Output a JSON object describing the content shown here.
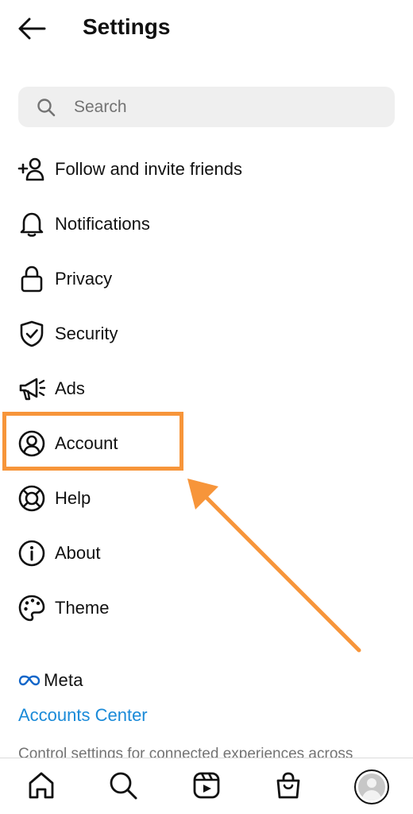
{
  "header": {
    "title": "Settings"
  },
  "search": {
    "placeholder": "Search"
  },
  "menu": {
    "items": [
      {
        "label": "Follow and invite friends",
        "icon": "add-person-icon"
      },
      {
        "label": "Notifications",
        "icon": "bell-icon"
      },
      {
        "label": "Privacy",
        "icon": "lock-icon"
      },
      {
        "label": "Security",
        "icon": "shield-check-icon"
      },
      {
        "label": "Ads",
        "icon": "megaphone-icon"
      },
      {
        "label": "Account",
        "icon": "user-circle-icon"
      },
      {
        "label": "Help",
        "icon": "lifebuoy-icon"
      },
      {
        "label": "About",
        "icon": "info-icon"
      },
      {
        "label": "Theme",
        "icon": "palette-icon"
      }
    ]
  },
  "annotation": {
    "highlighted_item": "Account",
    "color": "#f7953a"
  },
  "meta": {
    "logo_text": "Meta",
    "accounts_center": "Accounts Center",
    "description": "Control settings for connected experiences across"
  },
  "bottom_nav": {
    "items": [
      "home-icon",
      "search-icon",
      "reels-icon",
      "shop-icon",
      "profile-avatar"
    ]
  },
  "colors": {
    "link": "#1a8ad8",
    "search_bg": "#efefef",
    "accent": "#f7953a"
  }
}
